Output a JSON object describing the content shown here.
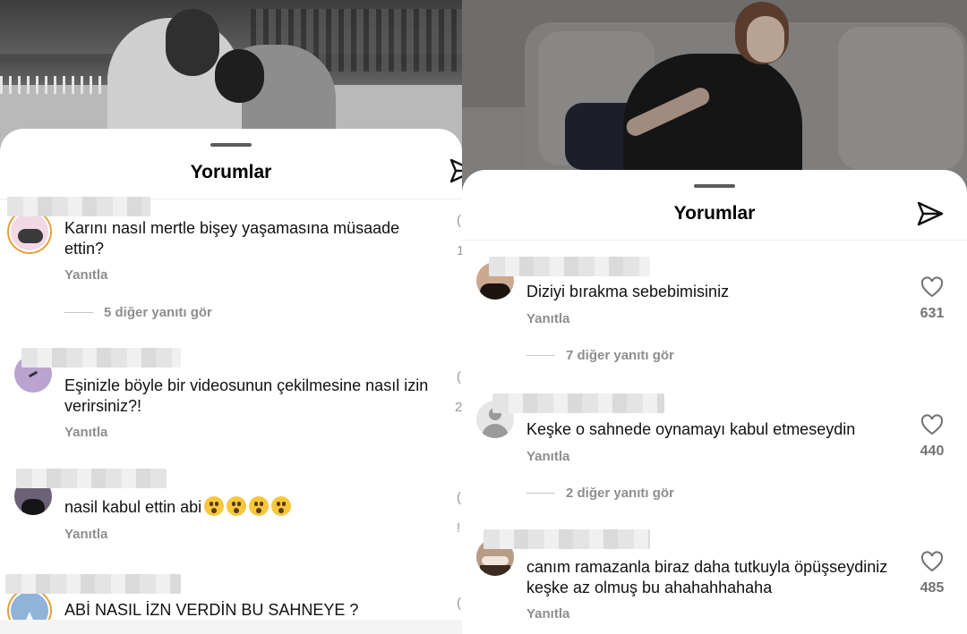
{
  "left": {
    "sheet_title": "Yorumlar",
    "comments": [
      {
        "text": "Karını nasıl mertle bişey yaşamasına müsaade ettin?",
        "reply": "Yanıtla",
        "more": "5 diğer yanıtı gör",
        "cut_icon": "(",
        "cut_count": "1"
      },
      {
        "text": "Eşinizle böyle bir videosunun çekilmesine nasıl izin verirsiniz?!",
        "reply": "Yanıtla",
        "cut_icon": "(",
        "cut_count": "2"
      },
      {
        "text": "nasil kabul ettin abi",
        "emoji_count": 4,
        "reply": "Yanıtla",
        "cut_icon": "(",
        "cut_count": "!"
      },
      {
        "text": "ABİ NASIL İZN VERDİN BU SAHNEYE ?",
        "cut_icon": "("
      }
    ]
  },
  "right": {
    "sheet_title": "Yorumlar",
    "comments": [
      {
        "text": "Diziyi bırakma sebebimisiniz",
        "reply": "Yanıtla",
        "likes": "631",
        "more": "7 diğer yanıtı gör"
      },
      {
        "text": "Keşke o sahnede oynamayı kabul etmeseydin",
        "reply": "Yanıtla",
        "likes": "440",
        "more": "2 diğer yanıtı gör"
      },
      {
        "text": "canım ramazanla biraz daha tutkuyla öpüşseydiniz keşke az olmuş bu ahahahhahaha",
        "reply": "Yanıtla",
        "likes": "485"
      }
    ]
  },
  "colors": {
    "muted": "#8e8e8e",
    "like_count": "#737373",
    "story_ring": "#e4a13a"
  },
  "icons": [
    "send-icon",
    "heart-icon"
  ]
}
